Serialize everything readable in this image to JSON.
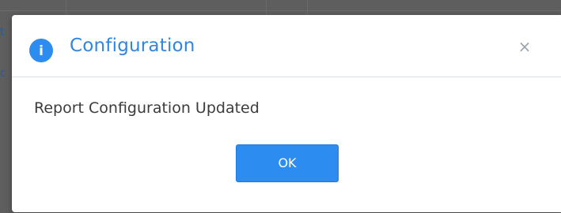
{
  "dialog": {
    "title": "Configuration",
    "close_glyph": "×",
    "message": "Report Configuration Updated",
    "ok_label": "OK",
    "info_icon": "info-circle-icon",
    "info_glyph": "i"
  },
  "colors": {
    "accent": "#2f86e0",
    "button": "#2d8cf0",
    "overlay": "#5e5e5e"
  }
}
